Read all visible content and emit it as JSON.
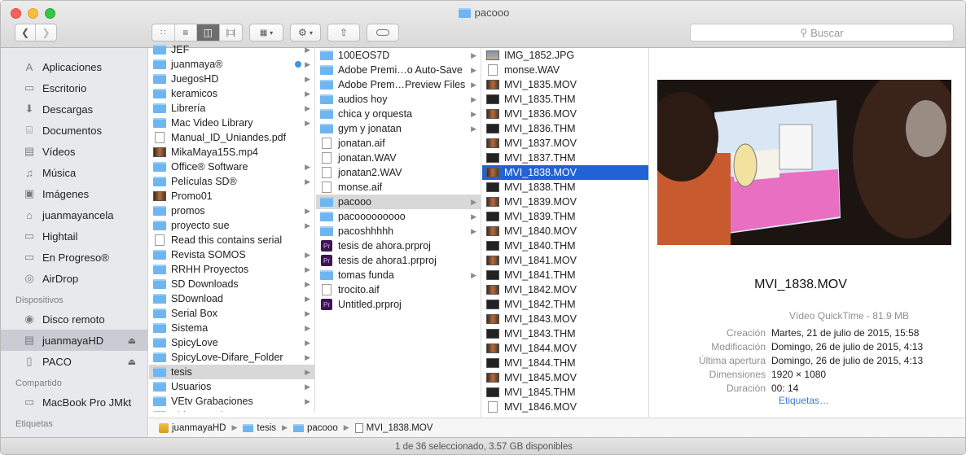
{
  "window": {
    "title": "pacooo"
  },
  "toolbar": {
    "search_placeholder": "Buscar"
  },
  "sidebar": {
    "favorites": [
      {
        "label": "Aplicaciones",
        "icon": "applications-icon"
      },
      {
        "label": "Escritorio",
        "icon": "desktop-icon"
      },
      {
        "label": "Descargas",
        "icon": "downloads-icon"
      },
      {
        "label": "Documentos",
        "icon": "documents-icon"
      },
      {
        "label": "Vídeos",
        "icon": "movies-icon"
      },
      {
        "label": "Música",
        "icon": "music-icon"
      },
      {
        "label": "Imágenes",
        "icon": "pictures-icon"
      },
      {
        "label": "juanmayancela",
        "icon": "home-icon"
      },
      {
        "label": "Hightail",
        "icon": "folder-icon"
      },
      {
        "label": "En Progreso®",
        "icon": "folder-icon"
      },
      {
        "label": "AirDrop",
        "icon": "airdrop-icon"
      }
    ],
    "devices_header": "Dispositivos",
    "devices": [
      {
        "label": "Disco remoto",
        "icon": "remote-disc-icon"
      },
      {
        "label": "juanmayaHD",
        "icon": "hard-drive-icon"
      },
      {
        "label": "PACO",
        "icon": "drive-icon"
      }
    ],
    "shared_header": "Compartido",
    "shared": [
      {
        "label": "MacBook Pro JMkt",
        "icon": "computer-icon"
      }
    ],
    "tags_header": "Etiquetas"
  },
  "col1": [
    {
      "name": "JEF",
      "t": "fold",
      "arr": true
    },
    {
      "name": "juanmaya®",
      "t": "fold",
      "arr": true,
      "dot": true
    },
    {
      "name": "JuegosHD",
      "t": "fold",
      "arr": true
    },
    {
      "name": "keramicos",
      "t": "fold",
      "arr": true
    },
    {
      "name": "Librería",
      "t": "fold",
      "arr": true
    },
    {
      "name": "Mac Video Library",
      "t": "fold",
      "arr": true
    },
    {
      "name": "Manual_ID_Uniandes.pdf",
      "t": "doc"
    },
    {
      "name": "MikaMaya15S.mp4",
      "t": "vid"
    },
    {
      "name": "Office® Software",
      "t": "fold",
      "arr": true
    },
    {
      "name": "Películas SD®",
      "t": "fold",
      "arr": true
    },
    {
      "name": "Promo01",
      "t": "vid"
    },
    {
      "name": "promos",
      "t": "fold",
      "arr": true
    },
    {
      "name": "proyecto sue",
      "t": "fold",
      "arr": true
    },
    {
      "name": "Read this contains serial",
      "t": "doc"
    },
    {
      "name": "Revista SOMOS",
      "t": "fold",
      "arr": true
    },
    {
      "name": "RRHH Proyectos",
      "t": "fold",
      "arr": true
    },
    {
      "name": "SD Downloads",
      "t": "fold",
      "arr": true
    },
    {
      "name": "SDownload",
      "t": "fold",
      "arr": true
    },
    {
      "name": "Serial Box",
      "t": "fold",
      "arr": true
    },
    {
      "name": "Sistema",
      "t": "fold",
      "arr": true
    },
    {
      "name": "SpicyLove",
      "t": "fold",
      "arr": true
    },
    {
      "name": "SpicyLove-Difare_Folder",
      "t": "fold",
      "arr": true
    },
    {
      "name": "tesis",
      "t": "fold",
      "arr": true,
      "hl": true
    },
    {
      "name": "Usuarios",
      "t": "fold",
      "arr": true
    },
    {
      "name": "VEtv Grabaciones",
      "t": "fold",
      "arr": true
    },
    {
      "name": "Video Arquitectura",
      "t": "fold",
      "arr": true
    }
  ],
  "col2": [
    {
      "name": "100EOS7D",
      "t": "fold",
      "arr": true
    },
    {
      "name": "Adobe Premi…o Auto-Save",
      "t": "fold",
      "arr": true
    },
    {
      "name": "Adobe Prem…Preview Files",
      "t": "fold",
      "arr": true
    },
    {
      "name": "audios hoy",
      "t": "fold",
      "arr": true
    },
    {
      "name": "chica y orquesta",
      "t": "fold",
      "arr": true
    },
    {
      "name": "gym y jonatan",
      "t": "fold",
      "arr": true
    },
    {
      "name": "jonatan.aif",
      "t": "doc"
    },
    {
      "name": "jonatan.WAV",
      "t": "doc"
    },
    {
      "name": "jonatan2.WAV",
      "t": "doc"
    },
    {
      "name": "monse.aif",
      "t": "doc"
    },
    {
      "name": "pacooo",
      "t": "fold",
      "arr": true,
      "hl": true
    },
    {
      "name": "pacooooooooo",
      "t": "fold",
      "arr": true
    },
    {
      "name": "pacoshhhhh",
      "t": "fold",
      "arr": true
    },
    {
      "name": "tesis de ahora.prproj",
      "t": "pr"
    },
    {
      "name": "tesis de ahora1.prproj",
      "t": "pr"
    },
    {
      "name": "tomas funda",
      "t": "fold",
      "arr": true
    },
    {
      "name": "trocito.aif",
      "t": "doc"
    },
    {
      "name": "Untitled.prproj",
      "t": "pr"
    }
  ],
  "col3": [
    {
      "name": "IMG_1852.JPG",
      "t": "img"
    },
    {
      "name": "monse.WAV",
      "t": "doc"
    },
    {
      "name": "MVI_1835.MOV",
      "t": "vid"
    },
    {
      "name": "MVI_1835.THM",
      "t": "thm"
    },
    {
      "name": "MVI_1836.MOV",
      "t": "vid"
    },
    {
      "name": "MVI_1836.THM",
      "t": "thm"
    },
    {
      "name": "MVI_1837.MOV",
      "t": "vid"
    },
    {
      "name": "MVI_1837.THM",
      "t": "thm"
    },
    {
      "name": "MVI_1838.MOV",
      "t": "vid",
      "sel": true
    },
    {
      "name": "MVI_1838.THM",
      "t": "thm"
    },
    {
      "name": "MVI_1839.MOV",
      "t": "vid"
    },
    {
      "name": "MVI_1839.THM",
      "t": "thm"
    },
    {
      "name": "MVI_1840.MOV",
      "t": "vid"
    },
    {
      "name": "MVI_1840.THM",
      "t": "thm"
    },
    {
      "name": "MVI_1841.MOV",
      "t": "vid"
    },
    {
      "name": "MVI_1841.THM",
      "t": "thm"
    },
    {
      "name": "MVI_1842.MOV",
      "t": "vid"
    },
    {
      "name": "MVI_1842.THM",
      "t": "thm"
    },
    {
      "name": "MVI_1843.MOV",
      "t": "vid"
    },
    {
      "name": "MVI_1843.THM",
      "t": "thm"
    },
    {
      "name": "MVI_1844.MOV",
      "t": "vid"
    },
    {
      "name": "MVI_1844.THM",
      "t": "thm"
    },
    {
      "name": "MVI_1845.MOV",
      "t": "vid"
    },
    {
      "name": "MVI_1845.THM",
      "t": "thm"
    },
    {
      "name": "MVI_1846.MOV",
      "t": "doc"
    }
  ],
  "preview": {
    "name": "MVI_1838.MOV",
    "kind": "Vídeo QuickTime - 81.9 MB",
    "meta": [
      {
        "k": "Creación",
        "v": "Martes, 21 de julio de 2015, 15:58"
      },
      {
        "k": "Modificación",
        "v": "Domingo, 26 de julio de 2015, 4:13"
      },
      {
        "k": "Última apertura",
        "v": "Domingo, 26 de julio de 2015, 4:13"
      },
      {
        "k": "Dimensiones",
        "v": "1920 × 1080"
      },
      {
        "k": "Duración",
        "v": "00: 14"
      }
    ],
    "tags_link": "Etiquetas…"
  },
  "pathbar": [
    "juanmayaHD",
    "tesis",
    "pacooo",
    "MVI_1838.MOV"
  ],
  "status": "1 de 36 seleccionado, 3.57 GB disponibles"
}
